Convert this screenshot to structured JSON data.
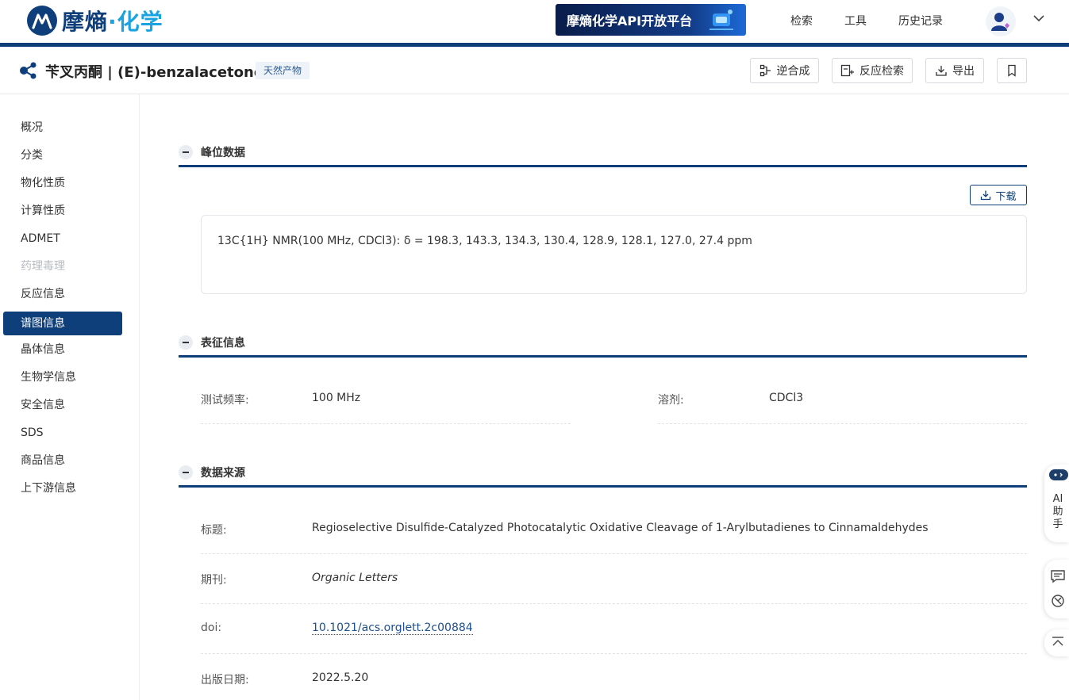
{
  "brand": {
    "name_part1": "摩熵",
    "dot": "·",
    "name_part2": "化学"
  },
  "api_banner": {
    "label": "摩熵化学API开放平台"
  },
  "nav": {
    "search": "检索",
    "tools": "工具",
    "history": "历史记录"
  },
  "compound": {
    "title": "苄叉丙酮 | (E)-benzalacetone",
    "tag": "天然产物"
  },
  "toolbar": {
    "retrosynthesis": "逆合成",
    "reaction_search": "反应检索",
    "export": "导出"
  },
  "sidebar": {
    "items": [
      {
        "label": "概况"
      },
      {
        "label": "分类"
      },
      {
        "label": "物化性质"
      },
      {
        "label": "计算性质"
      },
      {
        "label": "ADMET"
      },
      {
        "label": "药理毒理"
      },
      {
        "label": "反应信息"
      },
      {
        "label": "谱图信息"
      },
      {
        "label": "晶体信息"
      },
      {
        "label": "生物学信息"
      },
      {
        "label": "安全信息"
      },
      {
        "label": "SDS"
      },
      {
        "label": "商品信息"
      },
      {
        "label": "上下游信息"
      }
    ],
    "active": "谱图信息",
    "disabled": "药理毒理"
  },
  "sections": {
    "peak": {
      "title": "峰位数据",
      "download_label": "下载",
      "text": "13C{1H} NMR(100 MHz, CDCl3): δ = 198.3, 143.3, 134.3, 130.4, 128.9, 128.1, 127.0, 27.4 ppm"
    },
    "characterization": {
      "title": "表征信息",
      "frequency_label": "测试频率:",
      "frequency_value": "100 MHz",
      "solvent_label": "溶剂:",
      "solvent_value": "CDCl3"
    },
    "source": {
      "title": "数据来源",
      "title_label": "标题:",
      "title_value": "Regioselective Disulfide-Catalyzed Photocatalytic Oxidative Cleavage of 1-Arylbutadienes to Cinnamaldehydes",
      "journal_label": "期刊:",
      "journal_value": "Organic Letters",
      "doi_label": "doi:",
      "doi_value": "10.1021/acs.orglett.2c00884",
      "date_label": "出版日期:",
      "date_value": "2022.5.20"
    }
  },
  "floating": {
    "ai_label": "AI助手"
  },
  "colors": {
    "primary": "#0f3f7a",
    "accent": "#1ba3e0"
  }
}
